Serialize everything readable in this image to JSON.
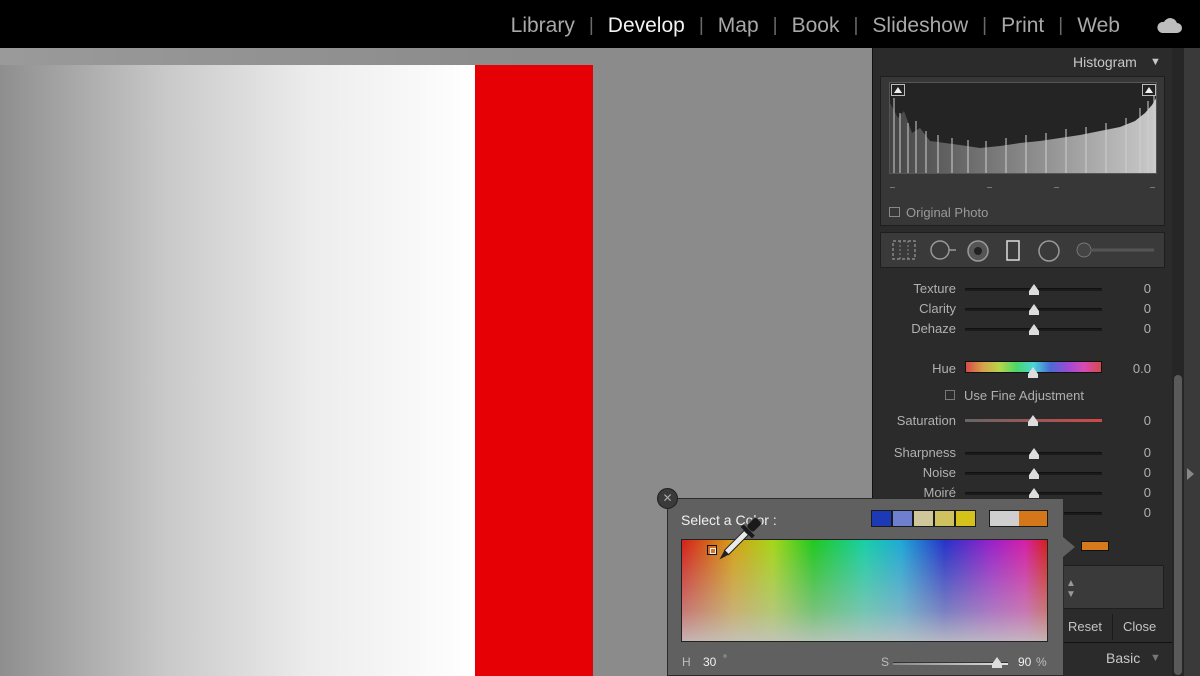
{
  "topbar": {
    "modules": [
      "Library",
      "Develop",
      "Map",
      "Book",
      "Slideshow",
      "Print",
      "Web"
    ],
    "active_module": "Develop"
  },
  "histogram": {
    "title": "Histogram",
    "original_photo_label": "Original Photo"
  },
  "adjustments": {
    "sliders_top": [
      {
        "label": "Texture",
        "value": "0",
        "position": 0.5
      },
      {
        "label": "Clarity",
        "value": "0",
        "position": 0.5
      },
      {
        "label": "Dehaze",
        "value": "0",
        "position": 0.5
      }
    ],
    "hue": {
      "label": "Hue",
      "value": "0.0",
      "position": 0.5
    },
    "fine_adjustment_label": "Use Fine Adjustment",
    "saturation": {
      "label": "Saturation",
      "value": "0",
      "position": 0.5
    },
    "sliders_bottom": [
      {
        "label": "Sharpness",
        "value": "0",
        "position": 0.5
      },
      {
        "label": "Noise",
        "value": "0",
        "position": 0.5
      },
      {
        "label": "Moiré",
        "value": "0",
        "position": 0.5
      },
      {
        "label": "",
        "value": "0",
        "position": 0.5
      }
    ],
    "mask_color_swatch": "#d47a1c"
  },
  "panel_buttons": {
    "reset_label": "Reset",
    "close_label": "Close",
    "basic_label": "Basic"
  },
  "color_picker": {
    "title": "Select a Color :",
    "preset_swatches": [
      "#1c3ab5",
      "#6f7fcf",
      "#cfc69a",
      "#cfc160",
      "#d4c21a"
    ],
    "current_color_before": "#cfcfcf",
    "current_color_after": "#d4761a",
    "hue_label": "H",
    "hue_value": "30",
    "hue_unit": "°",
    "saturation_label": "S",
    "saturation_value": "90",
    "saturation_unit": "%",
    "saturation_position": 0.9
  },
  "photo": {
    "red_block_color": "#e60005"
  }
}
